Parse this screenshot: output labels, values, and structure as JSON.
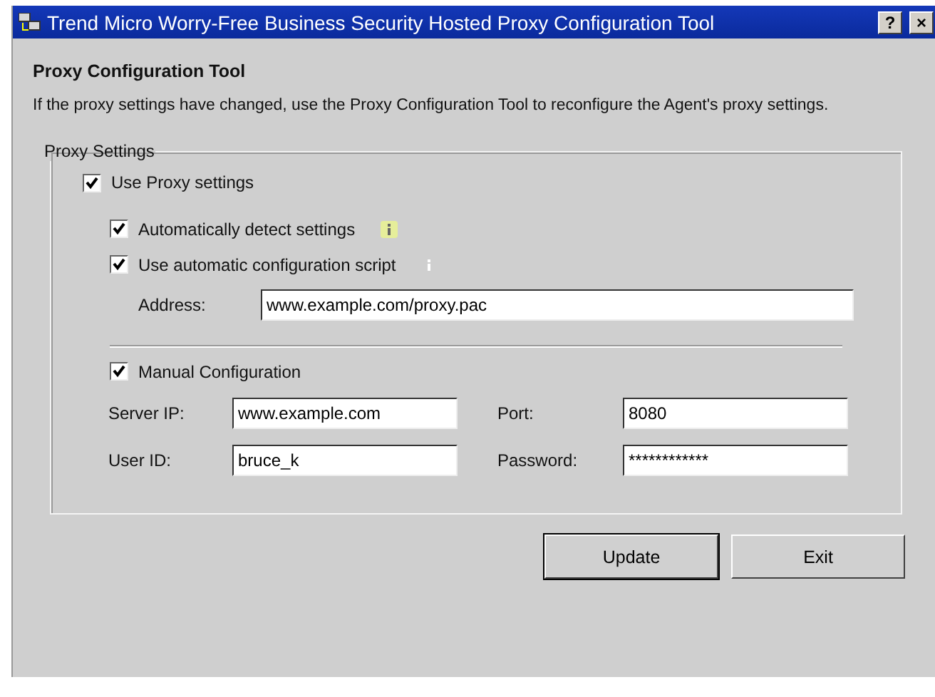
{
  "window": {
    "title": "Trend Micro Worry-Free Business Security Hosted Proxy Configuration Tool",
    "help_button": "?",
    "close_button": "×"
  },
  "heading": "Proxy Configuration Tool",
  "description": "If the proxy settings have changed, use the Proxy Configuration Tool to reconfigure the Agent's proxy settings.",
  "group": {
    "title": "Proxy Settings",
    "use_proxy": {
      "label": "Use Proxy settings",
      "checked": true
    },
    "auto_detect": {
      "label": "Automatically detect settings",
      "checked": true
    },
    "auto_script": {
      "label": "Use automatic configuration script",
      "checked": true
    },
    "address": {
      "label": "Address:",
      "value": "www.example.com/proxy.pac"
    },
    "manual": {
      "label": "Manual Configuration",
      "checked": true
    },
    "fields": [
      {
        "label": "Server IP:",
        "value": "www.example.com"
      },
      {
        "label": "Port:",
        "value": "8080"
      },
      {
        "label": "User ID:",
        "value": "bruce_k"
      },
      {
        "label": "Password:",
        "value": "************"
      }
    ]
  },
  "buttons": [
    "Update",
    "Exit"
  ]
}
